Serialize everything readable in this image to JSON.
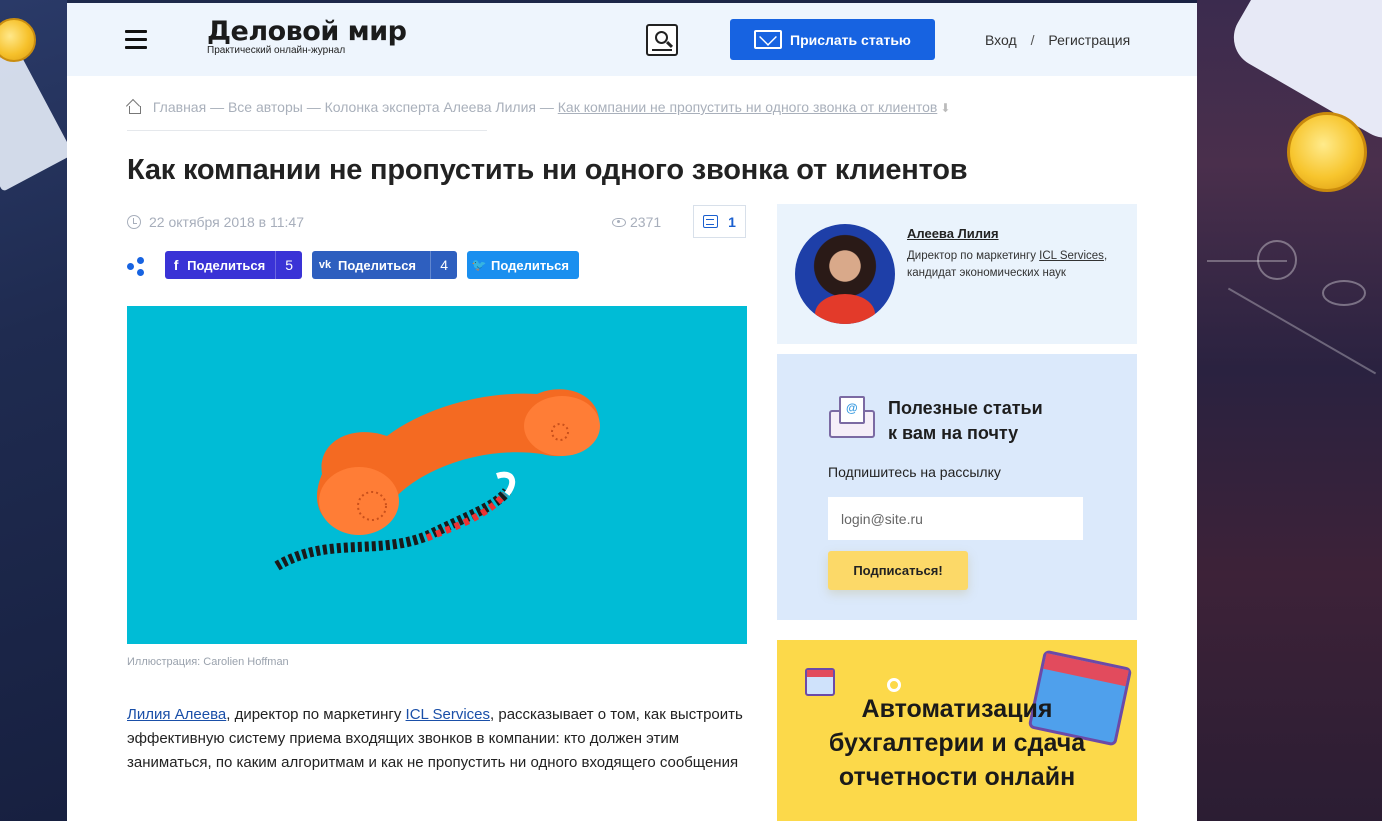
{
  "header": {
    "logo_name": "Деловой мир",
    "logo_tagline": "Практический онлайн-журнал",
    "send_article_label": "Прислать статью",
    "login_label": "Вход",
    "auth_separator": "/",
    "register_label": "Регистрация"
  },
  "breadcrumb": {
    "home": "Главная",
    "sep": "—",
    "authors": "Все авторы",
    "column": "Колонка эксперта Алеева Лилия",
    "current": "Как компании не пропустить ни одного звонка от клиентов",
    "arrow": "➜"
  },
  "article": {
    "title": "Как компании не пропустить ни одного звонка от клиентов",
    "date": "22 октября 2018 в 11:47",
    "views": "2371",
    "comments": "1",
    "caption": "Иллюстрация: Carolien Hoffman",
    "lead_author": "Лилия Алеева",
    "lead_text_1": ", директор по маркетингу ",
    "lead_company": "ICL Services",
    "lead_text_2": ", рассказывает о том, как выстроить эффективную систему приема входящих звонков в компании: кто должен этим заниматься, по каким алгоритмам и как не пропустить ни одного входящего сообщения"
  },
  "share": {
    "facebook": {
      "icon": "f",
      "label": "Поделиться",
      "count": "5"
    },
    "vk": {
      "icon": "vk",
      "label": "Поделиться",
      "count": "4"
    },
    "twitter": {
      "icon": "tw",
      "label": "Поделиться"
    }
  },
  "author": {
    "name": "Алеева Лилия",
    "role_1": "Директор по маркетингу ",
    "role_company": "ICL Services",
    "role_2": ", кандидат экономических наук"
  },
  "newsletter": {
    "title_1": "Полезные статьи",
    "title_2": "к вам на почту",
    "subtitle": "Подпишитесь на рассылку",
    "placeholder": "login@site.ru",
    "button_label": "Подписаться!"
  },
  "promo": {
    "line_1": "Автоматизация",
    "line_2": "бухгалтерии и сдача",
    "line_3": "отчетности онлайн"
  },
  "colors": {
    "accent_blue": "#1763e1",
    "header_bg": "#eef5fd",
    "hero_bg": "#00bcd6",
    "subscribe_btn": "#fcd968",
    "promo_bg": "#fcd94a"
  }
}
